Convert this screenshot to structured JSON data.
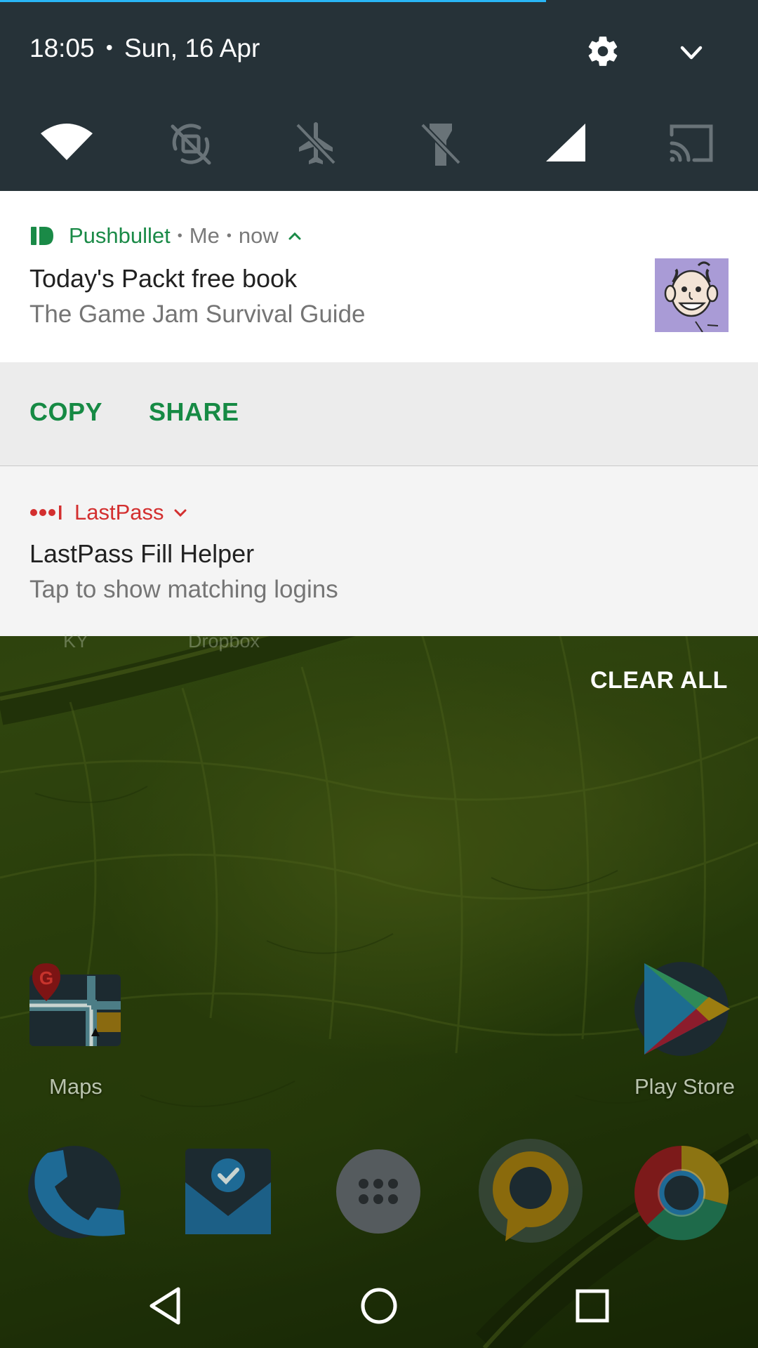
{
  "status": {
    "time": "18:05",
    "date": "Sun, 16 Apr",
    "separator": "•",
    "download_progress": 0.72
  },
  "quick_tiles": [
    {
      "icon": "wifi-icon"
    },
    {
      "icon": "auto-rotate-off-icon"
    },
    {
      "icon": "airplane-mode-off-icon"
    },
    {
      "icon": "flashlight-off-icon"
    },
    {
      "icon": "cellular-signal-icon"
    },
    {
      "icon": "cast-icon"
    }
  ],
  "notifications": [
    {
      "app": "Pushbullet",
      "sender": "Me",
      "time": "now",
      "title": "Today's Packt free book",
      "text": "The Game Jam Survival Guide",
      "actions": [
        "COPY",
        "SHARE"
      ],
      "accent": "#1a8a47"
    },
    {
      "app": "LastPass",
      "title": "LastPass Fill Helper",
      "text": "Tap to show matching logins",
      "accent": "#d32f2f"
    }
  ],
  "clear_all": "CLEAR ALL",
  "home": {
    "faded_labels": [
      "KY",
      "Dropbox"
    ],
    "apps": [
      {
        "label": "Maps",
        "icon": "maps-icon"
      },
      {
        "label": "Play Store",
        "icon": "play-store-icon"
      }
    ],
    "dock": [
      {
        "icon": "phone-icon"
      },
      {
        "icon": "inbox-icon"
      },
      {
        "icon": "app-drawer-icon"
      },
      {
        "icon": "hangouts-icon"
      },
      {
        "icon": "chrome-icon"
      }
    ]
  },
  "navbar": [
    "back-icon",
    "home-icon",
    "recents-icon"
  ]
}
